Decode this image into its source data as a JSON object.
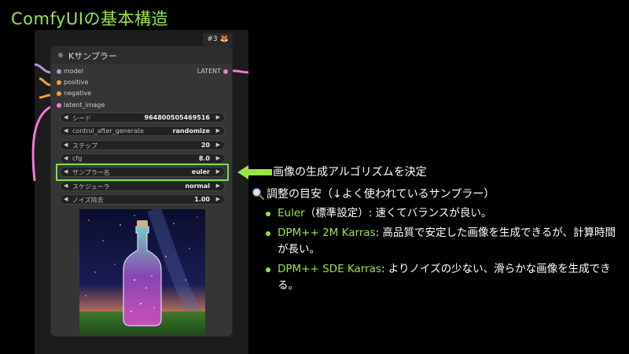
{
  "slide": {
    "title": "ComfyUIの基本構造"
  },
  "node": {
    "id_label": "#3",
    "id_glyph": "🦊",
    "title": "Kサンプラー",
    "inputs": [
      {
        "label": "model",
        "color": "#a99bd8"
      },
      {
        "label": "positive",
        "color": "#f0a23c"
      },
      {
        "label": "negative",
        "color": "#f0a23c"
      },
      {
        "label": "latent_image",
        "color": "#f47ad4"
      }
    ],
    "output": {
      "label": "LATENT",
      "color": "#f47ad4"
    },
    "widgets": [
      {
        "label": "シード",
        "value": "964800505469516"
      },
      {
        "label": "control_after_generate",
        "value": "randomize"
      },
      {
        "label": "ステップ",
        "value": "20"
      },
      {
        "label": "cfg",
        "value": "8.0"
      },
      {
        "label": "サンプラー名",
        "value": "euler"
      },
      {
        "label": "スケジューラ",
        "value": "normal"
      },
      {
        "label": "ノイズ除去",
        "value": "1.00"
      }
    ],
    "arrow_left": "◀",
    "arrow_right": "▶"
  },
  "annotation": {
    "title": "画像の生成アルゴリズムを決定",
    "tune_heading": "調整の目安（↓よく使われているサンプラー）",
    "icon": "magnifier-icon",
    "accent_color": "#9be44a",
    "samplers": [
      {
        "name": "Euler",
        "text": "（標準設定）: 速くてバランスが良い。"
      },
      {
        "name": "DPM++ 2M Karras",
        "text": ": 高品質で安定した画像を生成できるが、計算時間が長い。"
      },
      {
        "name": "DPM++ SDE Karras",
        "text": ": よりノイズの少ない、滑らかな画像を生成できる。"
      }
    ]
  }
}
